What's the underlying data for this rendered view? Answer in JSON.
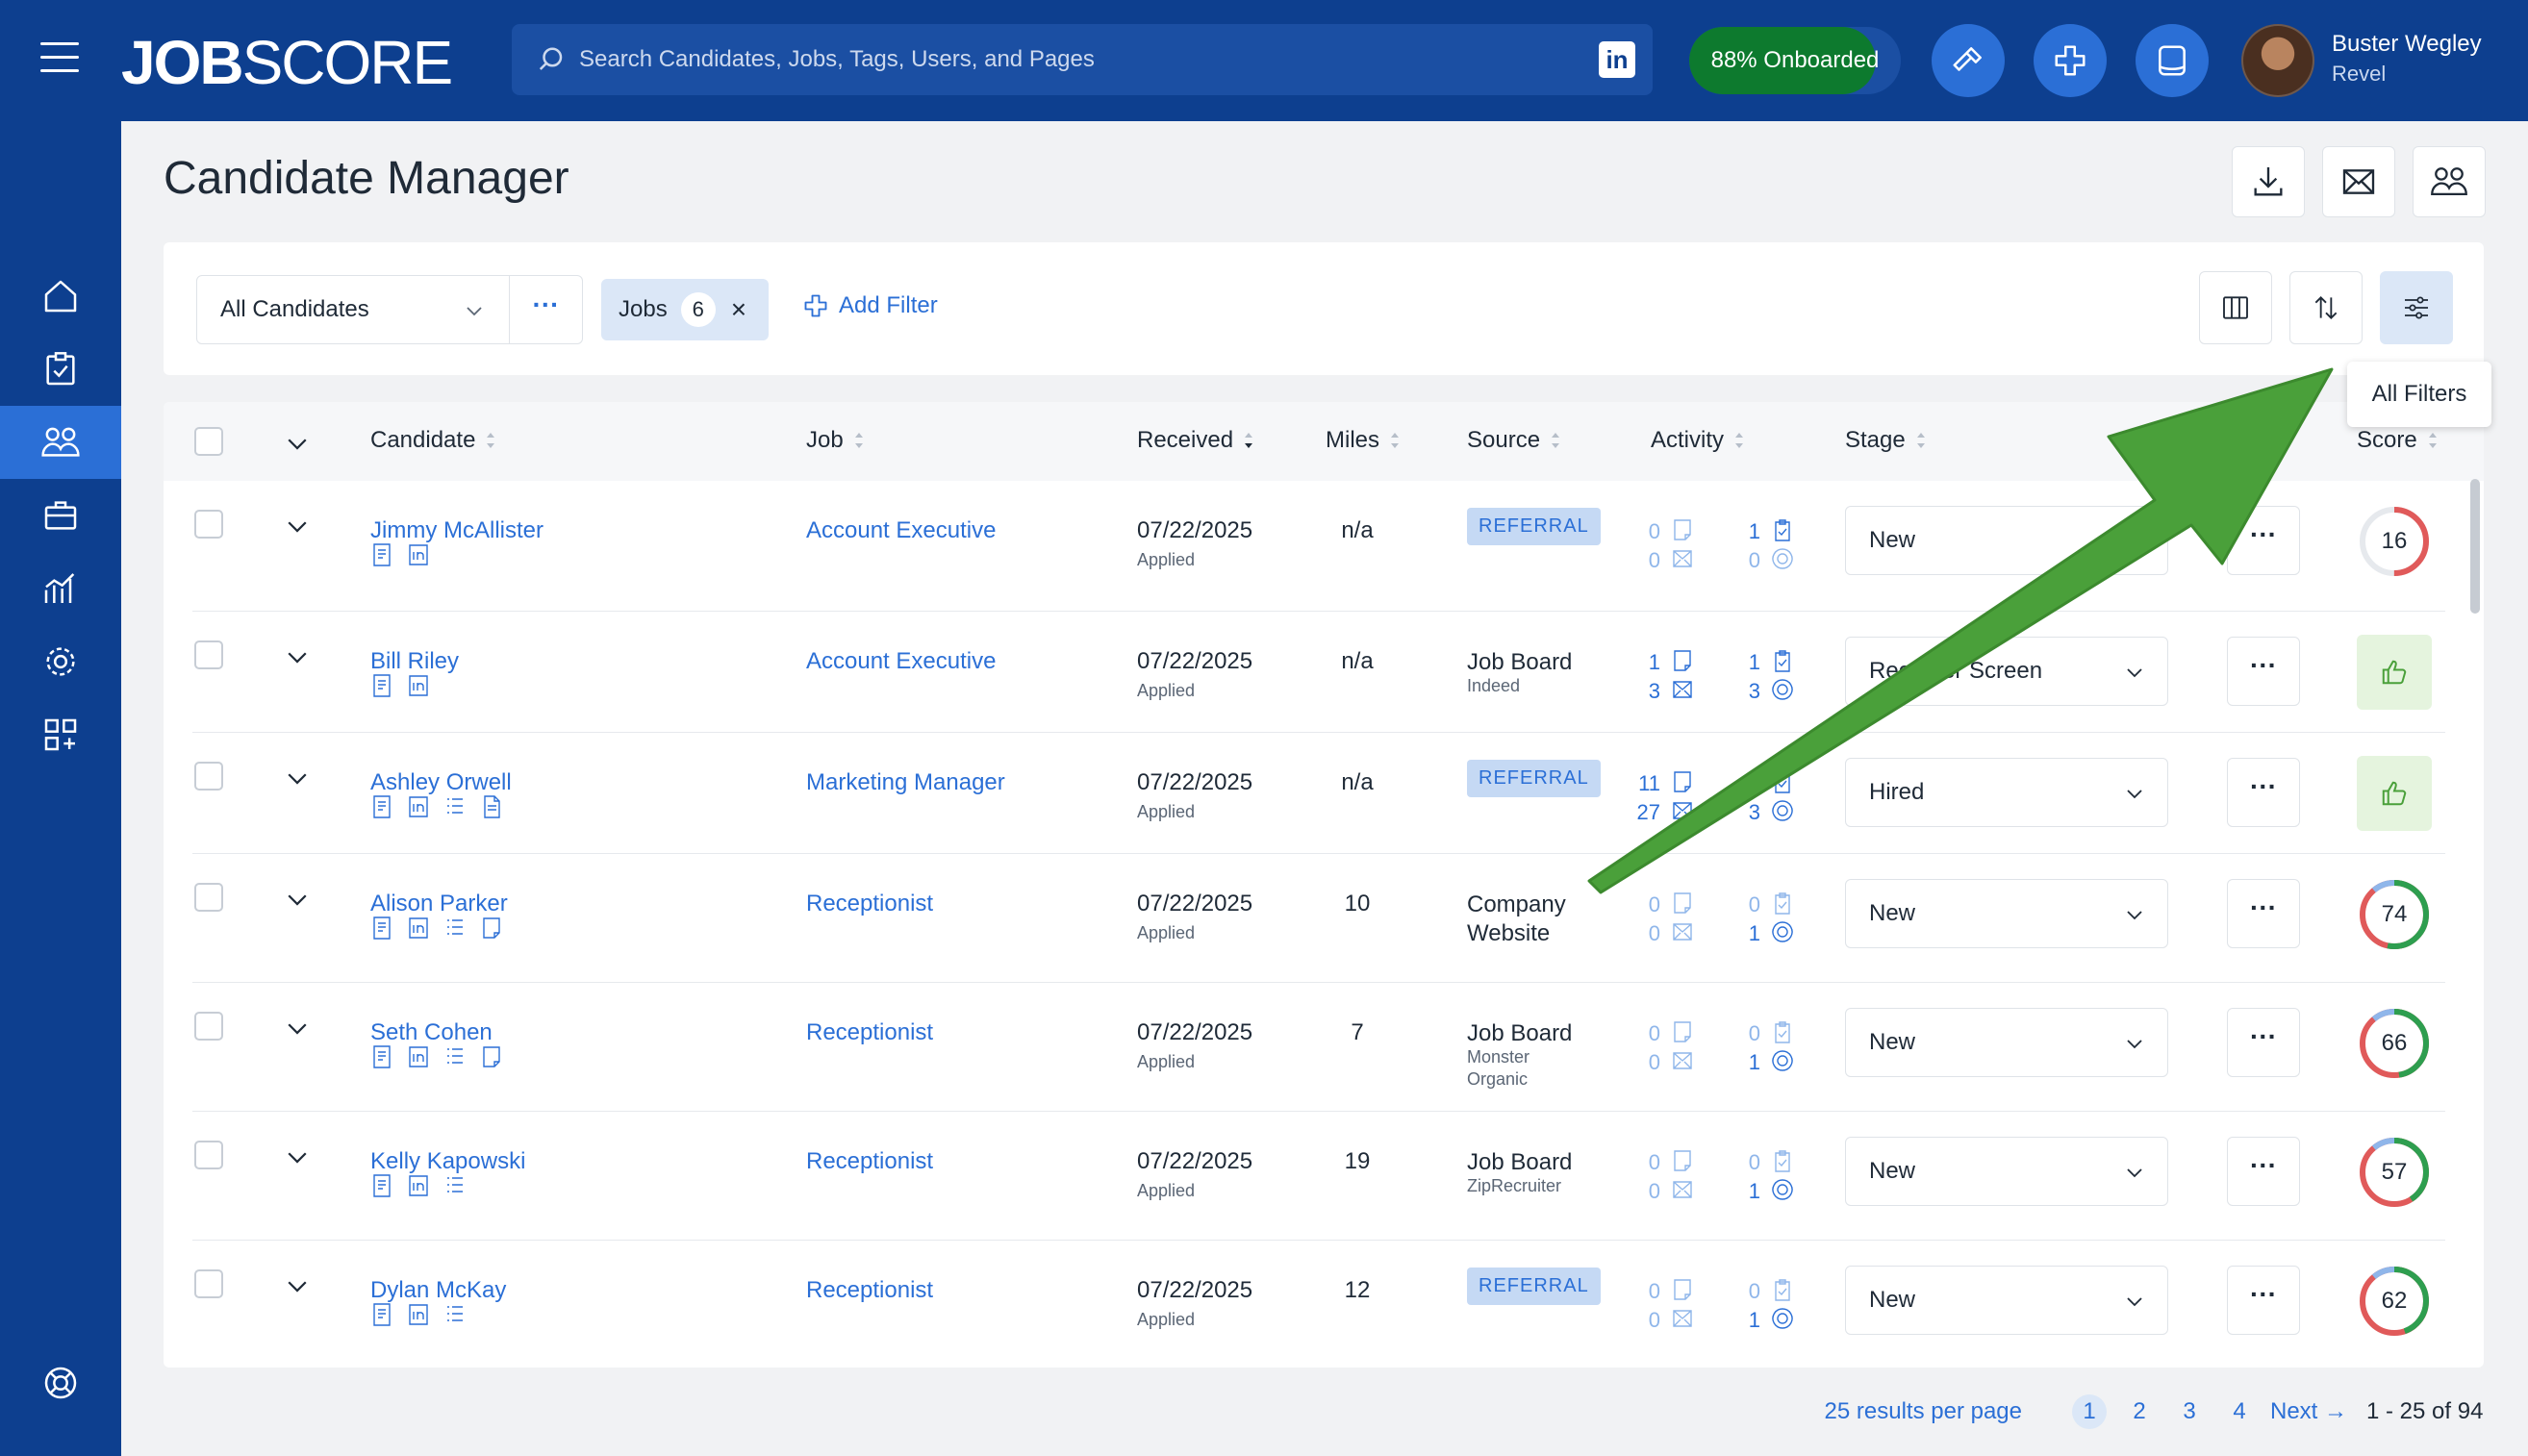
{
  "topbar": {
    "logo_job": "JOB",
    "logo_score": "SCORE",
    "search_placeholder": "Search Candidates, Jobs, Tags, Users, and Pages",
    "linkedin_label": "in",
    "onboarded_label": "88% Onboarded",
    "onboarded_progress": 0.88,
    "user_name": "Buster Wegley",
    "user_org": "Revel"
  },
  "sidenav": {
    "items": [
      "home-icon",
      "checklist-icon",
      "candidates-icon",
      "briefcase-icon",
      "analytics-icon",
      "settings-icon",
      "apps-icon"
    ],
    "active": "candidates-icon",
    "help": "help-icon"
  },
  "page": {
    "title": "Candidate Manager"
  },
  "filterbar": {
    "view_label": "All Candidates",
    "dots_label": "···",
    "jobs_chip_label": "Jobs",
    "jobs_chip_count": "6",
    "jobs_chip_close": "×",
    "add_filter_label": "Add Filter",
    "tooltip": "All Filters"
  },
  "table": {
    "columns": {
      "candidate": "Candidate",
      "job": "Job",
      "received": "Received",
      "miles": "Miles",
      "source": "Source",
      "activity": "Activity",
      "stage": "Stage",
      "score": "Score"
    },
    "rows": [
      {
        "name": "Jimmy McAllister",
        "job": "Account Executive",
        "date": "07/22/2025",
        "applied": "Applied",
        "miles": "n/a",
        "source_badge": "REFERRAL",
        "source_main": "",
        "source_sub": [],
        "act": [
          "0",
          "1",
          "0",
          "0"
        ],
        "stage": "New",
        "score": "16",
        "score_frac": 0.16,
        "score_color": "#e05a5a",
        "thumb": false
      },
      {
        "name": "Bill Riley",
        "job": "Account Executive",
        "date": "07/22/2025",
        "applied": "Applied",
        "miles": "n/a",
        "source_badge": "",
        "source_main": "Job Board",
        "source_sub": [
          "Indeed"
        ],
        "act": [
          "1",
          "1",
          "3",
          "3"
        ],
        "stage": "Recruiter Screen",
        "score": "",
        "score_frac": 0,
        "score_color": "",
        "thumb": true
      },
      {
        "name": "Ashley Orwell",
        "job": "Marketing Manager",
        "date": "07/22/2025",
        "applied": "Applied",
        "miles": "n/a",
        "source_badge": "REFERRAL",
        "source_main": "",
        "source_sub": [],
        "act": [
          "11",
          "",
          "27",
          "3"
        ],
        "stage": "Hired",
        "score": "",
        "score_frac": 0,
        "score_color": "",
        "thumb": true
      },
      {
        "name": "Alison Parker",
        "job": "Receptionist",
        "date": "07/22/2025",
        "applied": "Applied",
        "miles": "10",
        "source_badge": "",
        "source_main": "Company Website",
        "source_sub": [],
        "act": [
          "0",
          "0",
          "0",
          "1"
        ],
        "stage": "New",
        "score": "74",
        "score_frac": 0.74,
        "score_color": "#2e9e4f",
        "thumb": false
      },
      {
        "name": "Seth Cohen",
        "job": "Receptionist",
        "date": "07/22/2025",
        "applied": "Applied",
        "miles": "7",
        "source_badge": "",
        "source_main": "Job Board",
        "source_sub": [
          "Monster",
          "Organic"
        ],
        "act": [
          "0",
          "0",
          "0",
          "1"
        ],
        "stage": "New",
        "score": "66",
        "score_frac": 0.66,
        "score_color": "#2e9e4f",
        "thumb": false
      },
      {
        "name": "Kelly Kapowski",
        "job": "Receptionist",
        "date": "07/22/2025",
        "applied": "Applied",
        "miles": "19",
        "source_badge": "",
        "source_main": "Job Board",
        "source_sub": [
          "ZipRecruiter"
        ],
        "act": [
          "0",
          "0",
          "0",
          "1"
        ],
        "stage": "New",
        "score": "57",
        "score_frac": 0.57,
        "score_color": "#e05a5a",
        "thumb": false
      },
      {
        "name": "Dylan McKay",
        "job": "Receptionist",
        "date": "07/22/2025",
        "applied": "Applied",
        "miles": "12",
        "source_badge": "REFERRAL",
        "source_main": "",
        "source_sub": [],
        "act": [
          "0",
          "0",
          "0",
          "1"
        ],
        "stage": "New",
        "score": "62",
        "score_frac": 0.62,
        "score_color": "#2e9e4f",
        "thumb": false
      }
    ]
  },
  "footer": {
    "per_page": "25 results per page",
    "pages": [
      "1",
      "2",
      "3",
      "4"
    ],
    "active_page": "1",
    "next_label": "Next",
    "range_label": "1 - 25 of 94"
  },
  "colors": {
    "brand_navy": "#0d3f8f",
    "accent_blue": "#2b6fd6",
    "onboard_green": "#0d7a2e",
    "arrow_green": "#4aa03a"
  }
}
